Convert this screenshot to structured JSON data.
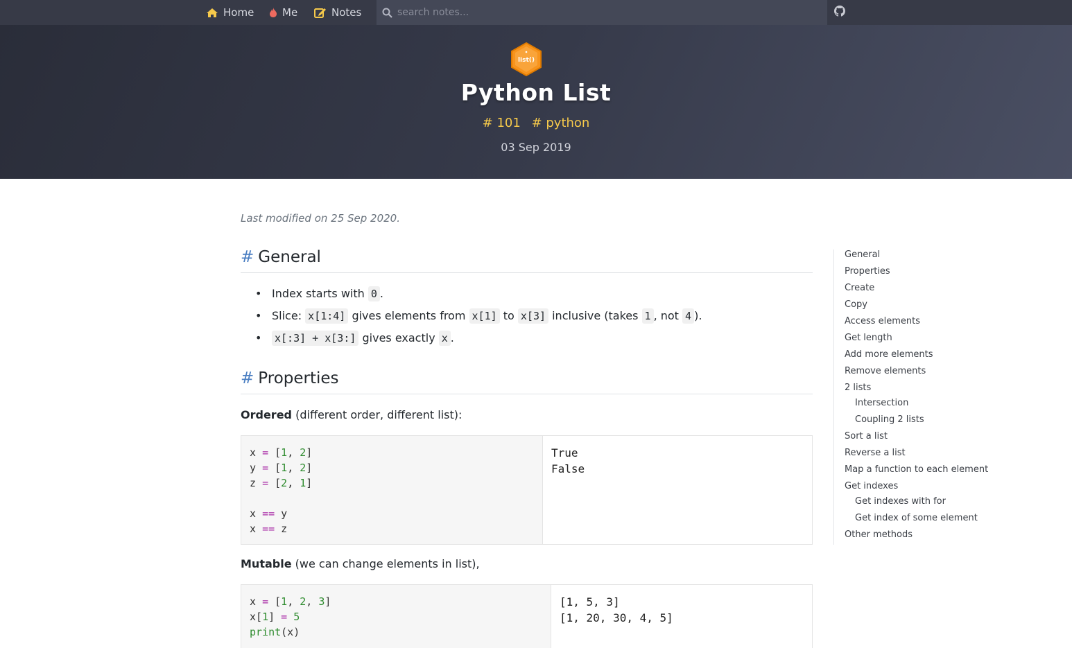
{
  "nav": {
    "home": "Home",
    "me": "Me",
    "notes": "Notes",
    "search_placeholder": "search notes...",
    "accent_color": "#f6c94b"
  },
  "hero": {
    "logo_text": "list()",
    "title": "Python List",
    "tags": [
      "# 101",
      "# python"
    ],
    "date": "03 Sep 2019"
  },
  "content": {
    "last_modified": "Last modified on 25 Sep 2020.",
    "general": {
      "hash": "#",
      "heading": "General",
      "bullets": {
        "b1_pre": "Index starts with",
        "b1_code": "0",
        "b1_post": ".",
        "b2_pre": "Slice:",
        "b2_code1": "x[1:4]",
        "b2_mid1": "gives elements from",
        "b2_code2": "x[1]",
        "b2_mid2": "to",
        "b2_code3": "x[3]",
        "b2_mid3": "inclusive (takes",
        "b2_code4": "1",
        "b2_mid4": ", not",
        "b2_code5": "4",
        "b2_post": ").",
        "b3_code1": "x[:3] + x[3:]",
        "b3_mid": "gives exactly",
        "b3_code2": "x",
        "b3_post": "."
      }
    },
    "properties": {
      "hash": "#",
      "heading": "Properties",
      "ordered_bold": "Ordered",
      "ordered_text": "(different order, different list):",
      "ordered_output": "True\nFalse",
      "mutable_bold": "Mutable",
      "mutable_text": "(we can change elements in list),",
      "mutable_output": "[1, 5, 3]\n[1, 20, 30, 4, 5]"
    }
  },
  "toc": {
    "items": [
      "General",
      "Properties",
      "Create",
      "Copy",
      "Access elements",
      "Get length",
      "Add more elements",
      "Remove elements",
      "2 lists",
      "Intersection",
      "Coupling 2 lists",
      "Sort a list",
      "Reverse a list",
      "Map a function to each element",
      "Get indexes",
      "Get indexes with for",
      "Get index of some element",
      "Other methods"
    ]
  }
}
